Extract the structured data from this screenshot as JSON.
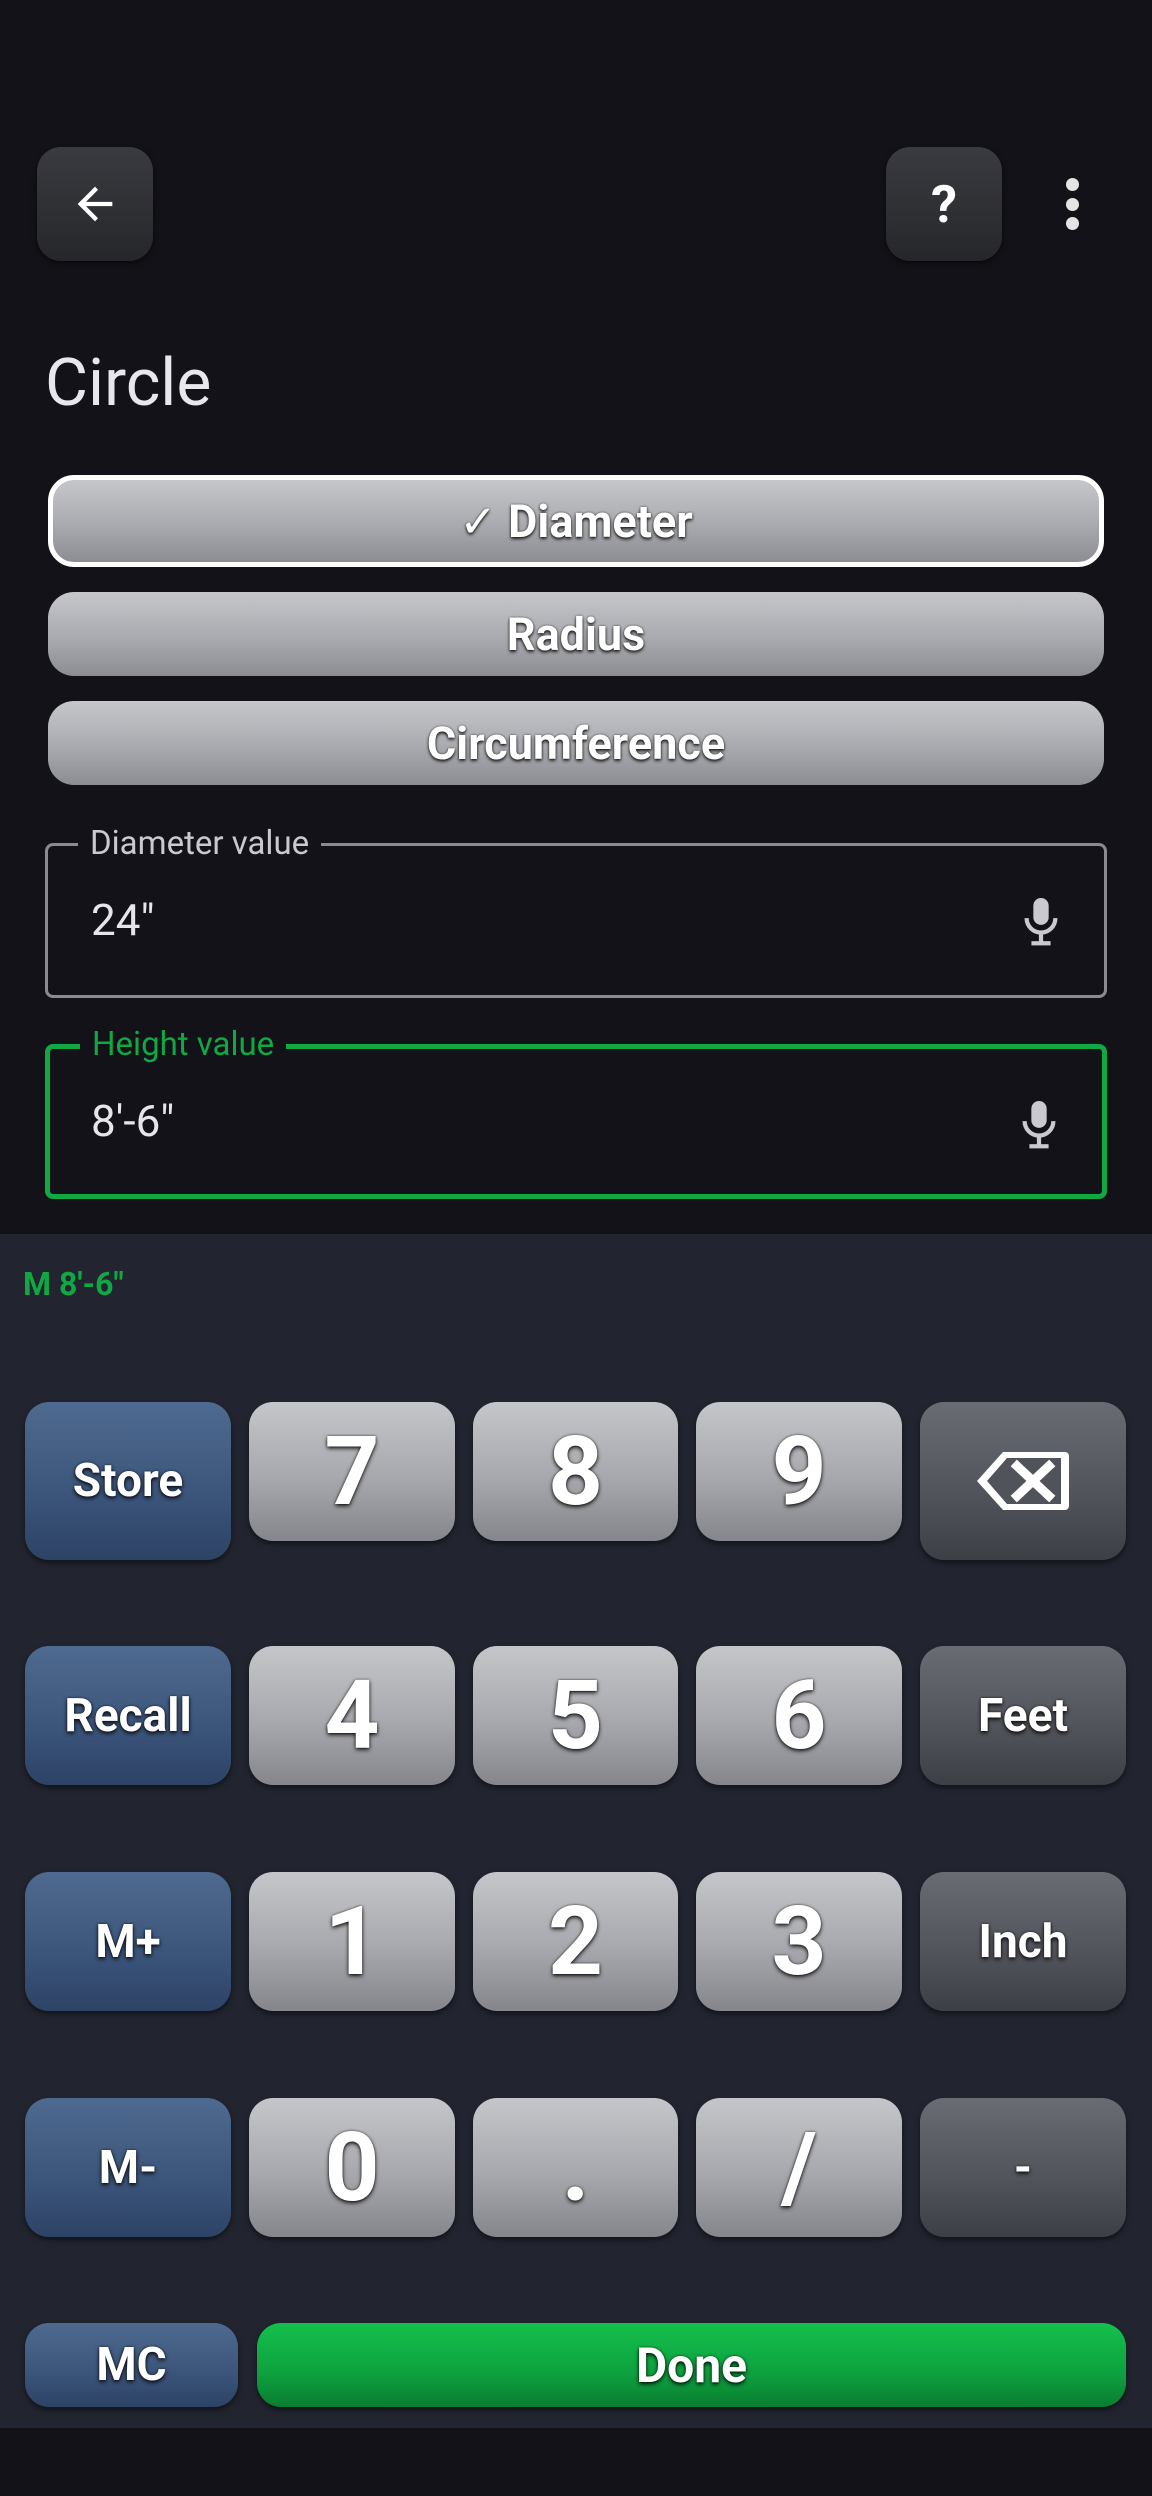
{
  "header": {
    "back_icon": "arrow-left-icon",
    "help_label": "?",
    "more_icon": "more-vert-icon"
  },
  "title": "Circle",
  "options": {
    "diameter": "✓ Diameter",
    "radius": "Radius",
    "circumference": "Circumference",
    "selected": "Diameter"
  },
  "fields": {
    "diameter": {
      "label": "Diameter value",
      "value": "24\""
    },
    "height": {
      "label": "Height value",
      "value": "8'-6\""
    }
  },
  "memory_display": "M 8'-6\"",
  "keypad": {
    "store": "Store",
    "recall": "Recall",
    "m_plus": "M+",
    "m_minus": "M-",
    "mc": "MC",
    "k7": "7",
    "k8": "8",
    "k9": "9",
    "k4": "4",
    "k5": "5",
    "k6": "6",
    "k1": "1",
    "k2": "2",
    "k3": "3",
    "k0": "0",
    "dot": ".",
    "slash": "/",
    "feet": "Feet",
    "inch": "Inch",
    "dash": "-",
    "backspace_icon": "backspace-icon",
    "done": "Done"
  },
  "colors": {
    "background": "#131218",
    "keypad_background": "#222530",
    "accent_green": "#10a843",
    "memory_key": "#3b547a"
  }
}
